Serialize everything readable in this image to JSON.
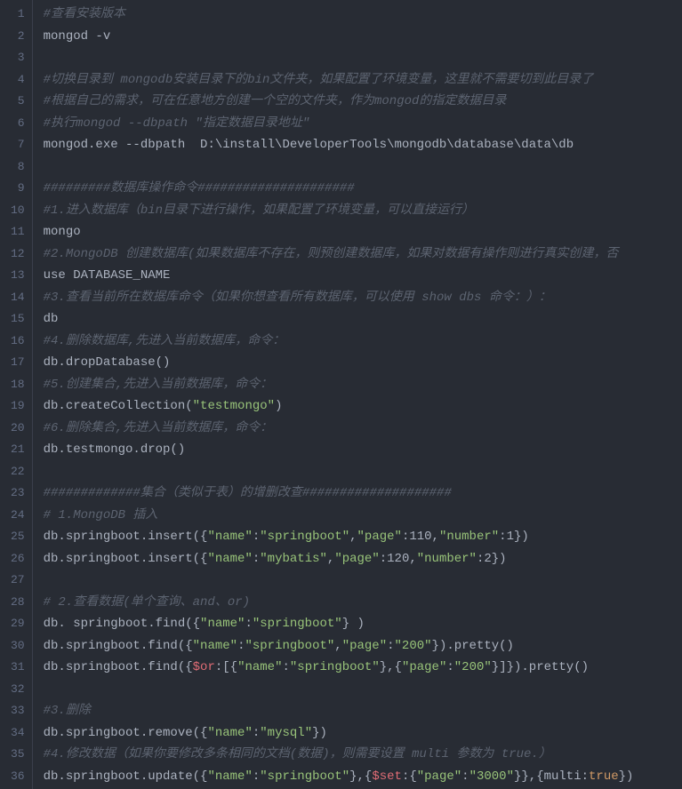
{
  "lines": [
    {
      "num": "1",
      "tokens": [
        {
          "t": "#查看安装版本",
          "c": "comment"
        }
      ]
    },
    {
      "num": "2",
      "tokens": [
        {
          "t": "mongod -v",
          "c": "plain"
        }
      ]
    },
    {
      "num": "3",
      "tokens": []
    },
    {
      "num": "4",
      "tokens": [
        {
          "t": "#切换目录到 mongodb安装目录下的bin文件夹，如果配置了环境变量，这里就不需要切到此目录了",
          "c": "comment"
        }
      ]
    },
    {
      "num": "5",
      "tokens": [
        {
          "t": "#根据自己的需求，可在任意地方创建一个空的文件夹，作为mongod的指定数据目录",
          "c": "comment"
        }
      ]
    },
    {
      "num": "6",
      "tokens": [
        {
          "t": "#执行mongod --dbpath \"指定数据目录地址\"",
          "c": "comment"
        }
      ]
    },
    {
      "num": "7",
      "tokens": [
        {
          "t": "mongod.exe --dbpath  D:\\install\\DeveloperTools\\mongodb\\database\\data\\db",
          "c": "plain"
        }
      ]
    },
    {
      "num": "8",
      "tokens": []
    },
    {
      "num": "9",
      "tokens": [
        {
          "t": "#########数据库操作命令#####################",
          "c": "comment"
        }
      ]
    },
    {
      "num": "10",
      "tokens": [
        {
          "t": "#1.进入数据库（bin目录下进行操作，如果配置了环境变量，可以直接运行）",
          "c": "comment"
        }
      ]
    },
    {
      "num": "11",
      "tokens": [
        {
          "t": "mongo",
          "c": "plain"
        }
      ]
    },
    {
      "num": "12",
      "tokens": [
        {
          "t": "#2.MongoDB 创建数据库(如果数据库不存在，则预创建数据库，如果对数据有操作则进行真实创建，否",
          "c": "comment"
        }
      ]
    },
    {
      "num": "13",
      "tokens": [
        {
          "t": "use DATABASE_NAME",
          "c": "plain"
        }
      ]
    },
    {
      "num": "14",
      "tokens": [
        {
          "t": "#3.查看当前所在数据库命令（如果你想查看所有数据库，可以使用 show dbs 命令：）：",
          "c": "comment"
        }
      ]
    },
    {
      "num": "15",
      "tokens": [
        {
          "t": "db",
          "c": "plain"
        }
      ]
    },
    {
      "num": "16",
      "tokens": [
        {
          "t": "#4.删除数据库,先进入当前数据库，命令：",
          "c": "comment"
        }
      ]
    },
    {
      "num": "17",
      "tokens": [
        {
          "t": "db.dropDatabase()",
          "c": "plain"
        }
      ]
    },
    {
      "num": "18",
      "tokens": [
        {
          "t": "#5.创建集合,先进入当前数据库，命令：",
          "c": "comment"
        }
      ]
    },
    {
      "num": "19",
      "tokens": [
        {
          "t": "db.createCollection(",
          "c": "plain"
        },
        {
          "t": "\"testmongo\"",
          "c": "string"
        },
        {
          "t": ")",
          "c": "plain"
        }
      ]
    },
    {
      "num": "20",
      "tokens": [
        {
          "t": "#6.删除集合,先进入当前数据库，命令：",
          "c": "comment"
        }
      ]
    },
    {
      "num": "21",
      "tokens": [
        {
          "t": "db.testmongo.drop()",
          "c": "plain"
        }
      ]
    },
    {
      "num": "22",
      "tokens": []
    },
    {
      "num": "23",
      "tokens": [
        {
          "t": "#############集合（类似于表）的增删改查####################",
          "c": "comment"
        }
      ]
    },
    {
      "num": "24",
      "tokens": [
        {
          "t": "# 1.MongoDB 插入",
          "c": "comment"
        }
      ]
    },
    {
      "num": "25",
      "tokens": [
        {
          "t": "db.springboot.insert({",
          "c": "plain"
        },
        {
          "t": "\"name\"",
          "c": "string"
        },
        {
          "t": ":",
          "c": "plain"
        },
        {
          "t": "\"springboot\"",
          "c": "string"
        },
        {
          "t": ",",
          "c": "plain"
        },
        {
          "t": "\"page\"",
          "c": "string"
        },
        {
          "t": ":110,",
          "c": "plain"
        },
        {
          "t": "\"number\"",
          "c": "string"
        },
        {
          "t": ":1})",
          "c": "plain"
        }
      ]
    },
    {
      "num": "26",
      "tokens": [
        {
          "t": "db.springboot.insert({",
          "c": "plain"
        },
        {
          "t": "\"name\"",
          "c": "string"
        },
        {
          "t": ":",
          "c": "plain"
        },
        {
          "t": "\"mybatis\"",
          "c": "string"
        },
        {
          "t": ",",
          "c": "plain"
        },
        {
          "t": "\"page\"",
          "c": "string"
        },
        {
          "t": ":120,",
          "c": "plain"
        },
        {
          "t": "\"number\"",
          "c": "string"
        },
        {
          "t": ":2})",
          "c": "plain"
        }
      ]
    },
    {
      "num": "27",
      "tokens": []
    },
    {
      "num": "28",
      "tokens": [
        {
          "t": "# 2.查看数据(单个查询、and、or)",
          "c": "comment"
        }
      ]
    },
    {
      "num": "29",
      "tokens": [
        {
          "t": "db. springboot.find({",
          "c": "plain"
        },
        {
          "t": "\"name\"",
          "c": "string"
        },
        {
          "t": ":",
          "c": "plain"
        },
        {
          "t": "\"springboot\"",
          "c": "string"
        },
        {
          "t": "} )",
          "c": "plain"
        }
      ]
    },
    {
      "num": "30",
      "tokens": [
        {
          "t": "db.springboot.find({",
          "c": "plain"
        },
        {
          "t": "\"name\"",
          "c": "string"
        },
        {
          "t": ":",
          "c": "plain"
        },
        {
          "t": "\"springboot\"",
          "c": "string"
        },
        {
          "t": ",",
          "c": "plain"
        },
        {
          "t": "\"page\"",
          "c": "string"
        },
        {
          "t": ":",
          "c": "plain"
        },
        {
          "t": "\"200\"",
          "c": "string"
        },
        {
          "t": "}).pretty()",
          "c": "plain"
        }
      ]
    },
    {
      "num": "31",
      "tokens": [
        {
          "t": "db.springboot.find({",
          "c": "plain"
        },
        {
          "t": "$or",
          "c": "attr"
        },
        {
          "t": ":[{",
          "c": "plain"
        },
        {
          "t": "\"name\"",
          "c": "string"
        },
        {
          "t": ":",
          "c": "plain"
        },
        {
          "t": "\"springboot\"",
          "c": "string"
        },
        {
          "t": "},{",
          "c": "plain"
        },
        {
          "t": "\"page\"",
          "c": "string"
        },
        {
          "t": ":",
          "c": "plain"
        },
        {
          "t": "\"200\"",
          "c": "string"
        },
        {
          "t": "}]}).pretty()",
          "c": "plain"
        }
      ]
    },
    {
      "num": "32",
      "tokens": []
    },
    {
      "num": "33",
      "tokens": [
        {
          "t": "#3.删除",
          "c": "comment"
        }
      ]
    },
    {
      "num": "34",
      "tokens": [
        {
          "t": "db.springboot.remove({",
          "c": "plain"
        },
        {
          "t": "\"name\"",
          "c": "string"
        },
        {
          "t": ":",
          "c": "plain"
        },
        {
          "t": "\"mysql\"",
          "c": "string"
        },
        {
          "t": "})",
          "c": "plain"
        }
      ]
    },
    {
      "num": "35",
      "tokens": [
        {
          "t": "#4.修改数据（如果你要修改多条相同的文档(数据)，则需要设置 multi 参数为 true.）",
          "c": "comment"
        }
      ]
    },
    {
      "num": "36",
      "tokens": [
        {
          "t": "db.springboot.update({",
          "c": "plain"
        },
        {
          "t": "\"name\"",
          "c": "string"
        },
        {
          "t": ":",
          "c": "plain"
        },
        {
          "t": "\"springboot\"",
          "c": "string"
        },
        {
          "t": "},{",
          "c": "plain"
        },
        {
          "t": "$set",
          "c": "attr"
        },
        {
          "t": ":{",
          "c": "plain"
        },
        {
          "t": "\"page\"",
          "c": "string"
        },
        {
          "t": ":",
          "c": "plain"
        },
        {
          "t": "\"3000\"",
          "c": "string"
        },
        {
          "t": "}},{multi:",
          "c": "plain"
        },
        {
          "t": "true",
          "c": "const"
        },
        {
          "t": "})",
          "c": "plain"
        }
      ]
    }
  ]
}
